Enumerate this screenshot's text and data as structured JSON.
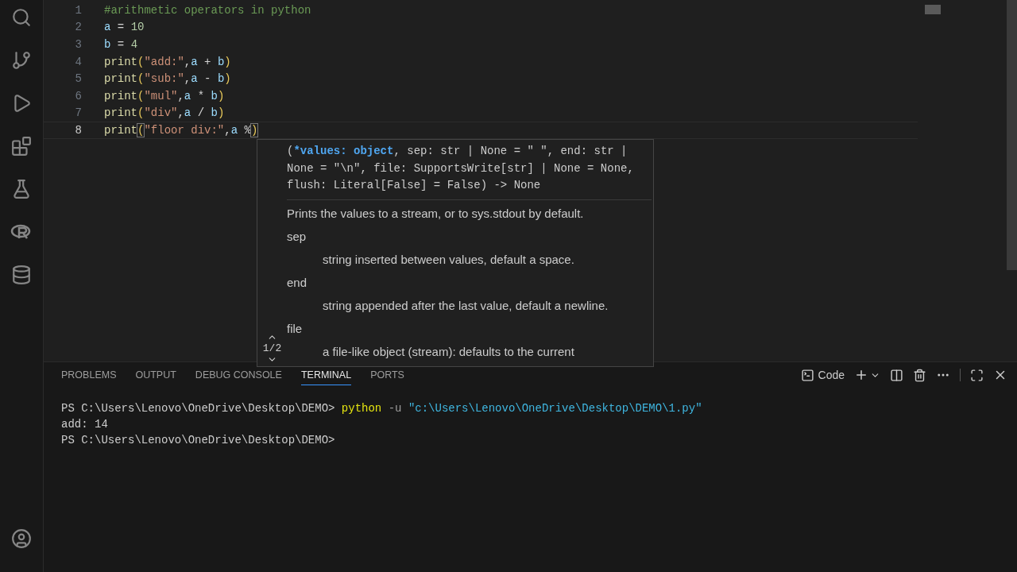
{
  "activity_bar": {
    "items": [
      {
        "kind": "search"
      },
      {
        "kind": "source-control"
      },
      {
        "kind": "run-debug"
      },
      {
        "kind": "extensions"
      },
      {
        "kind": "testing"
      },
      {
        "kind": "r"
      },
      {
        "kind": "database"
      }
    ],
    "bottom": [
      {
        "kind": "account"
      }
    ]
  },
  "editor": {
    "lines": [
      {
        "number": "1",
        "current": false,
        "tokens": [
          {
            "kind": "comment",
            "text": "#arithmetic operators in python"
          }
        ]
      },
      {
        "number": "2",
        "current": false,
        "tokens": [
          {
            "kind": "var",
            "text": "a"
          },
          {
            "kind": "op",
            "text": " = "
          },
          {
            "kind": "num",
            "text": "10"
          }
        ]
      },
      {
        "number": "3",
        "current": false,
        "tokens": [
          {
            "kind": "var",
            "text": "b"
          },
          {
            "kind": "op",
            "text": " = "
          },
          {
            "kind": "num",
            "text": "4"
          }
        ]
      },
      {
        "number": "4",
        "current": false,
        "tokens": [
          {
            "kind": "func",
            "text": "print"
          },
          {
            "kind": "paren",
            "text": "("
          },
          {
            "kind": "str",
            "text": "\"add:\""
          },
          {
            "kind": "op",
            "text": ","
          },
          {
            "kind": "var",
            "text": "a"
          },
          {
            "kind": "op",
            "text": " + "
          },
          {
            "kind": "var",
            "text": "b"
          },
          {
            "kind": "paren",
            "text": ")"
          }
        ]
      },
      {
        "number": "5",
        "current": false,
        "tokens": [
          {
            "kind": "func",
            "text": "print"
          },
          {
            "kind": "paren",
            "text": "("
          },
          {
            "kind": "str",
            "text": "\"sub:\""
          },
          {
            "kind": "op",
            "text": ","
          },
          {
            "kind": "var",
            "text": "a"
          },
          {
            "kind": "op",
            "text": " - "
          },
          {
            "kind": "var",
            "text": "b"
          },
          {
            "kind": "paren",
            "text": ")"
          }
        ]
      },
      {
        "number": "6",
        "current": false,
        "tokens": [
          {
            "kind": "func",
            "text": "print"
          },
          {
            "kind": "paren",
            "text": "("
          },
          {
            "kind": "str",
            "text": "\"mul\""
          },
          {
            "kind": "op",
            "text": ","
          },
          {
            "kind": "var",
            "text": "a"
          },
          {
            "kind": "op",
            "text": " * "
          },
          {
            "kind": "var",
            "text": "b"
          },
          {
            "kind": "paren",
            "text": ")"
          }
        ]
      },
      {
        "number": "7",
        "current": false,
        "tokens": [
          {
            "kind": "func",
            "text": "print"
          },
          {
            "kind": "paren",
            "text": "("
          },
          {
            "kind": "str",
            "text": "\"div\""
          },
          {
            "kind": "op",
            "text": ","
          },
          {
            "kind": "var",
            "text": "a"
          },
          {
            "kind": "op",
            "text": " / "
          },
          {
            "kind": "var",
            "text": "b"
          },
          {
            "kind": "paren",
            "text": ")"
          }
        ]
      },
      {
        "number": "8",
        "current": true,
        "tokens": [
          {
            "kind": "func",
            "text": "print"
          },
          {
            "kind": "match",
            "text": "("
          },
          {
            "kind": "str",
            "text": "\"floor div:\""
          },
          {
            "kind": "op",
            "text": ","
          },
          {
            "kind": "var",
            "text": "a"
          },
          {
            "kind": "op",
            "text": " %"
          },
          {
            "kind": "match",
            "text": ")"
          }
        ]
      }
    ]
  },
  "signature_help": {
    "signature": {
      "open": "(",
      "active": "*values: object",
      "rest": ", sep: str | None = \" \", end: str | None = \"\\n\", file: SupportsWrite[str] | None = None, flush: Literal[False] = False) -> None"
    },
    "description": "Prints the values to a stream, or to sys.stdout by default.",
    "params": [
      {
        "name": "sep",
        "desc": "string inserted between values, default a space."
      },
      {
        "name": "end",
        "desc": "string appended after the last value, default a newline."
      },
      {
        "name": "file",
        "desc": "a file-like object (stream): defaults to the current"
      }
    ],
    "pager": "1/2"
  },
  "panel": {
    "tabs": [
      {
        "label": "PROBLEMS",
        "selected": false
      },
      {
        "label": "OUTPUT",
        "selected": false
      },
      {
        "label": "DEBUG CONSOLE",
        "selected": false
      },
      {
        "label": "TERMINAL",
        "selected": true
      },
      {
        "label": "PORTS",
        "selected": false
      }
    ],
    "terminal_name": "Code",
    "terminal_lines": [
      [
        {
          "kind": "plain",
          "text": "PS C:\\Users\\Lenovo\\OneDrive\\Desktop\\DEMO> "
        },
        {
          "kind": "cmd",
          "text": "python"
        },
        {
          "kind": "flag",
          "text": " -u "
        },
        {
          "kind": "str",
          "text": "\"c:\\Users\\Lenovo\\OneDrive\\Desktop\\DEMO\\1.py\""
        }
      ],
      [
        {
          "kind": "plain",
          "text": "add: 14"
        }
      ],
      [
        {
          "kind": "plain",
          "text": "PS C:\\Users\\Lenovo\\OneDrive\\Desktop\\DEMO>"
        }
      ]
    ]
  }
}
